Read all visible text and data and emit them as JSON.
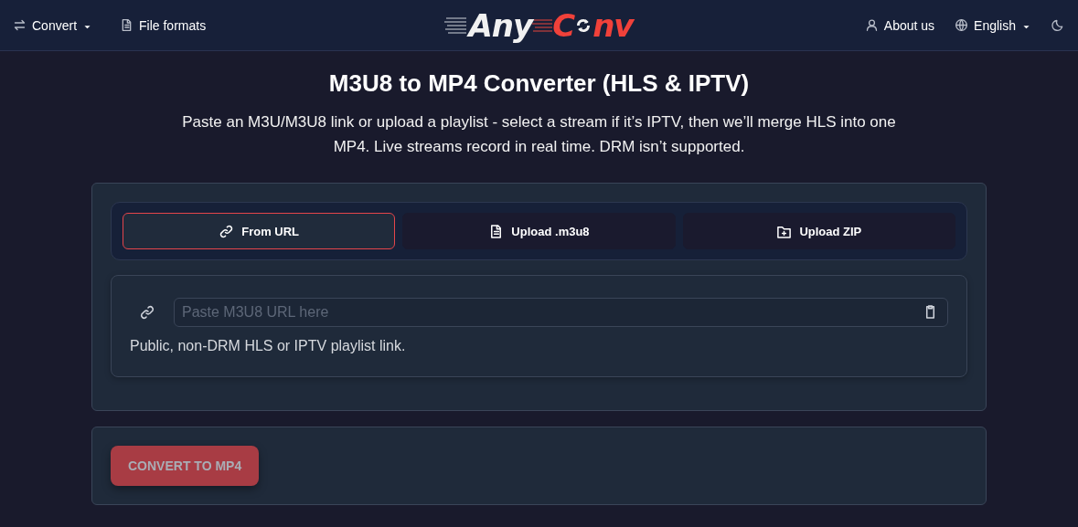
{
  "nav": {
    "left": [
      {
        "kind": "dropdown",
        "label": "Convert"
      },
      {
        "kind": "link",
        "label": "File formats"
      }
    ],
    "logo": {
      "part_1": "Any",
      "part_2": "C",
      "part_3": "nv"
    },
    "right": [
      {
        "kind": "link",
        "label": "About us"
      },
      {
        "kind": "dropdown",
        "label": "English"
      },
      {
        "kind": "theme"
      }
    ]
  },
  "heading": "M3U8 to MP4 Converter (HLS & IPTV)",
  "intro": "Paste an M3U/M3U8 link or upload a playlist - select a stream if it’s IPTV, then we’ll merge HLS into one MP4. Live streams record in real time. DRM isn’t supported.",
  "tabs": [
    {
      "label": "From URL",
      "kind": "link",
      "selected": true
    },
    {
      "label": "Upload .m3u8",
      "kind": "file",
      "selected": false
    },
    {
      "label": "Upload ZIP",
      "kind": "folder",
      "selected": false
    }
  ],
  "url_field": {
    "placeholder": "Paste M3U8 URL here",
    "hint": "Public, non-DRM HLS or IPTV playlist link."
  },
  "convert_button": {
    "label": "CONVERT TO MP4",
    "disabled": true
  }
}
